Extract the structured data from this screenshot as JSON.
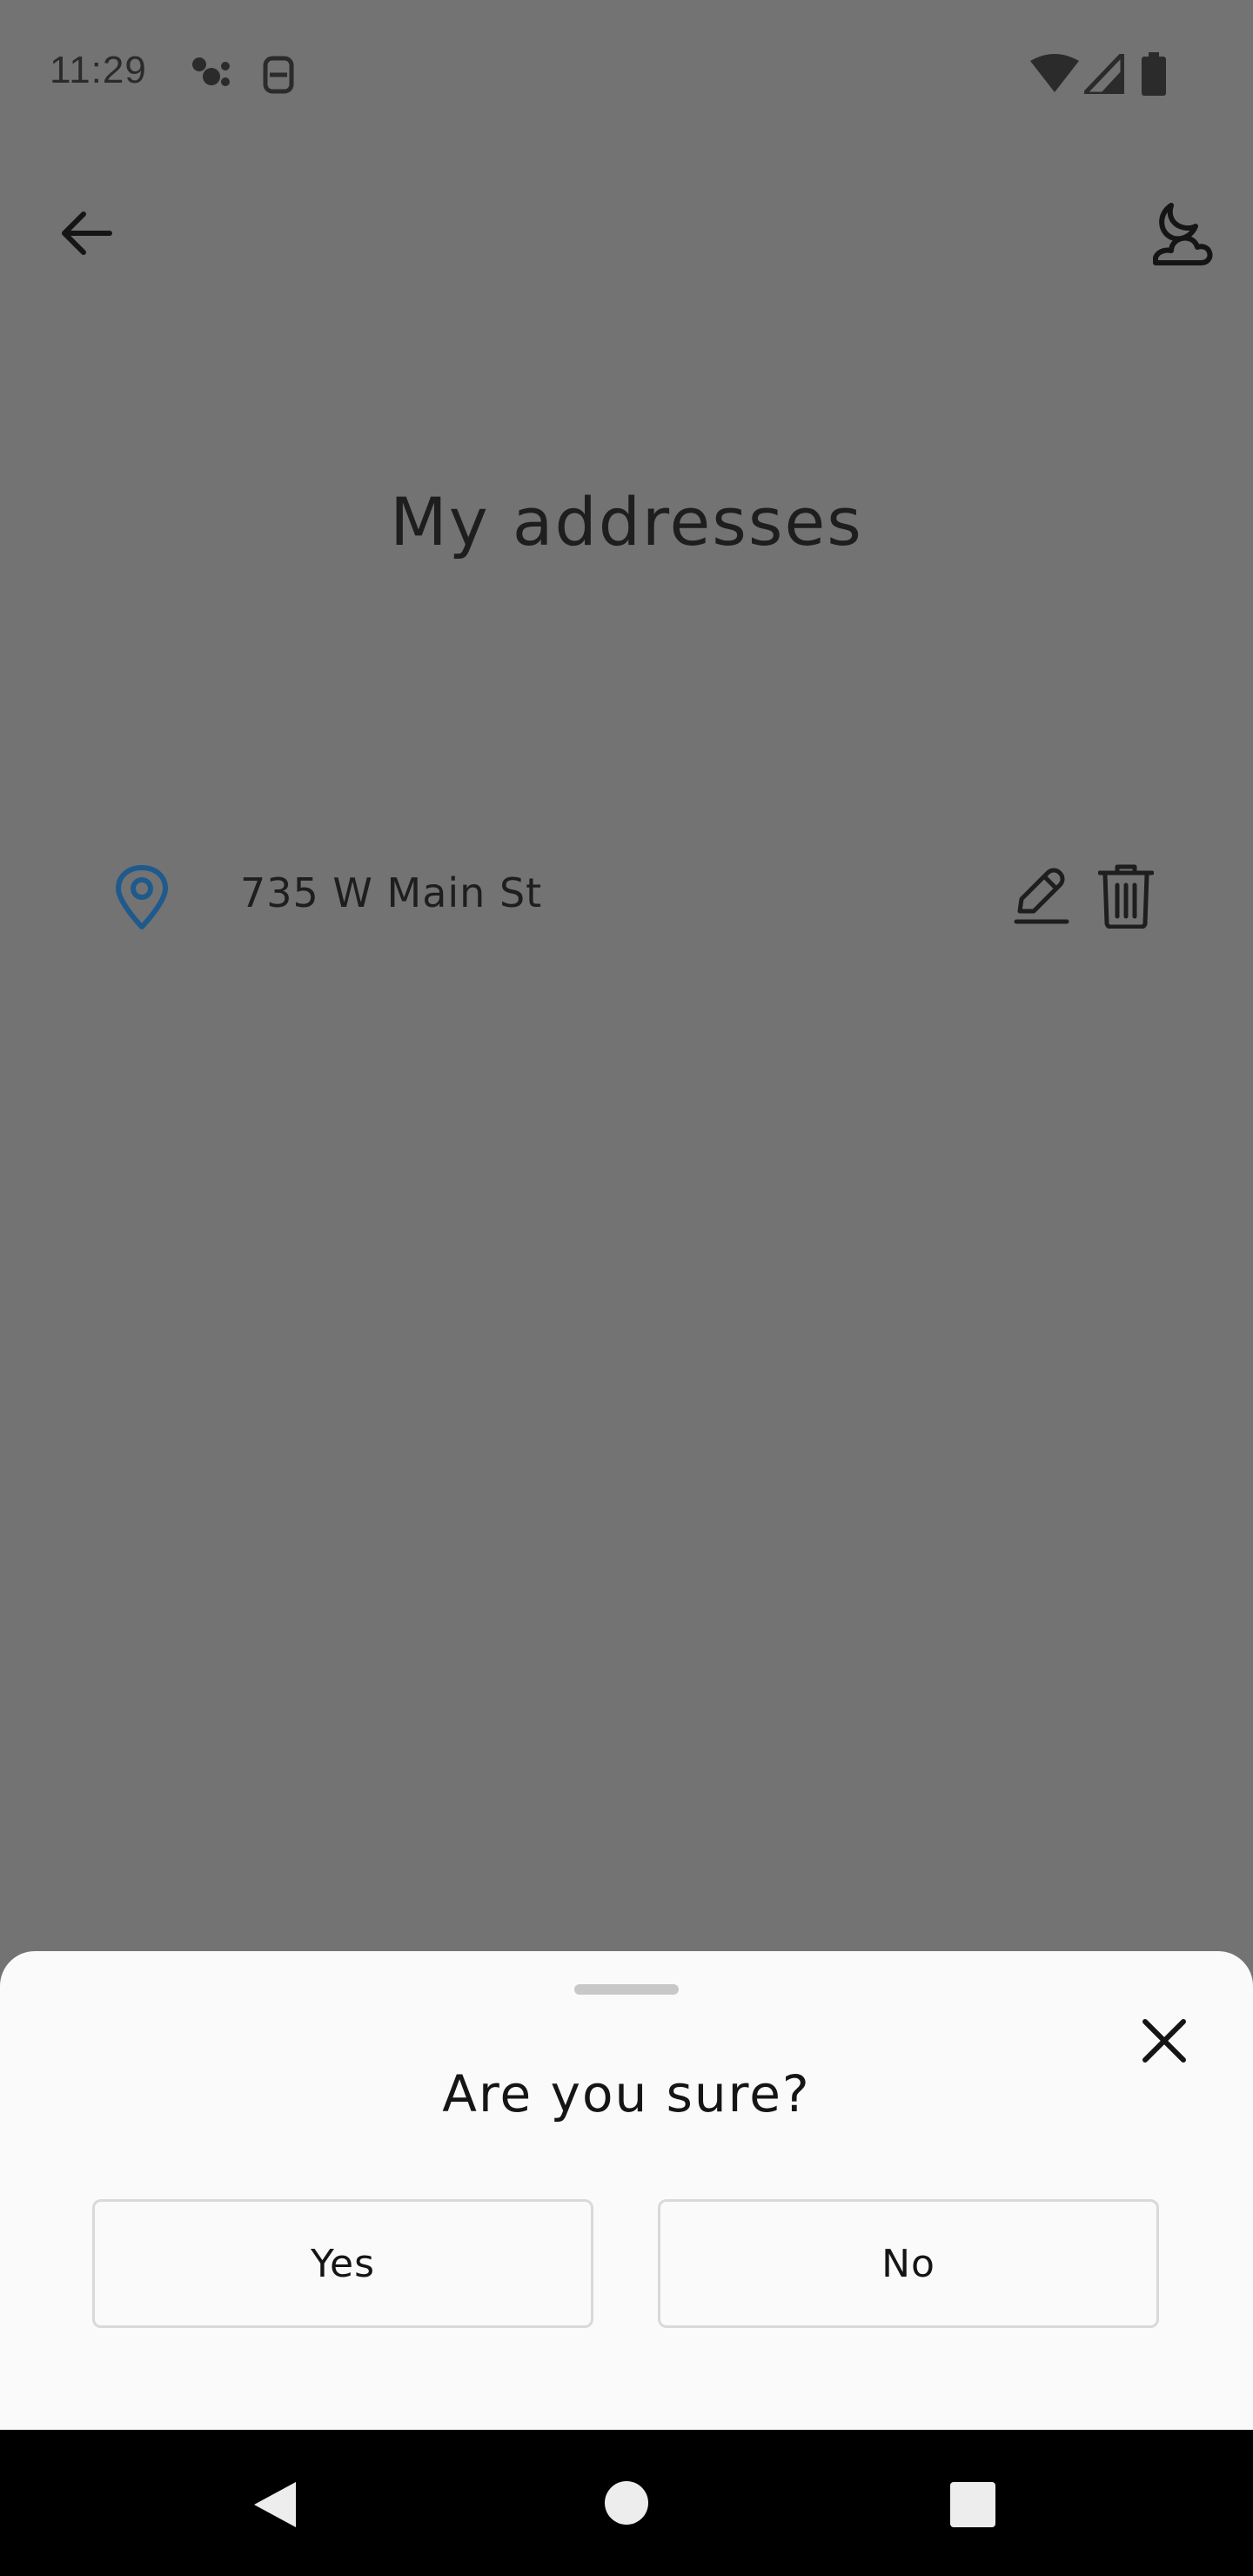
{
  "status_bar": {
    "time": "11:29",
    "icons": [
      "assistant-dots-icon",
      "sim-icon",
      "wifi-icon",
      "signal-icon",
      "battery-icon"
    ]
  },
  "toolbar": {
    "back_icon": "arrow-left-icon",
    "theme_icon": "moon-cloud-icon"
  },
  "page": {
    "title": "My addresses"
  },
  "addresses": [
    {
      "text": "735 W Main St",
      "icon": "location-pin-icon",
      "actions": [
        "edit-icon",
        "trash-icon"
      ]
    }
  ],
  "dialog": {
    "title": "Are you sure?",
    "yes_label": "Yes",
    "no_label": "No",
    "close_icon": "close-icon"
  },
  "navigation": {
    "buttons": [
      "back-triangle-icon",
      "home-circle-icon",
      "recents-square-icon"
    ]
  },
  "colors": {
    "scrim": "#737373",
    "sheet": "#fafafa",
    "pin": "#1f5a8c",
    "nav": "#000000"
  }
}
